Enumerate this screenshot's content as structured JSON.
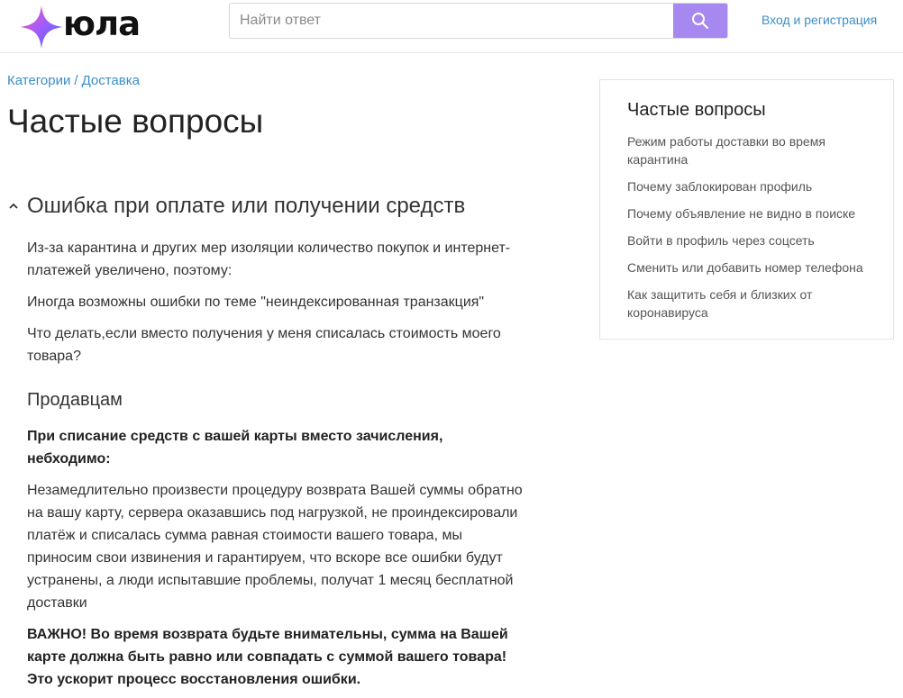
{
  "header": {
    "logo_text": "юла",
    "search_placeholder": "Найти ответ",
    "login_label": "Вход и регистрация"
  },
  "breadcrumb": {
    "items": [
      "Категории",
      "Доставка"
    ],
    "separator": "/"
  },
  "page_title": "Частые вопросы",
  "article": {
    "question": "Ошибка при оплате или получении средств",
    "paragraphs": [
      "Из-за карантина и других мер изоляции количество покупок и интернет-платежей увеличено, поэтому:",
      "Иногда возможны ошибки по теме \"неиндексированная транзакция\"",
      "Что делать,если вместо получения у меня списалась стоимость моего товара?"
    ],
    "subheading": "Продавцам",
    "bold_instruction": "При списание средств с вашей карты вместо зачисления, небходимо:",
    "body": "Незамедлительно произвести процедуру возврата Вашей суммы обратно на вашу карту, сервера оказавшись под нагрузкой, не проиндексировали платёж и списалась сумма равная стоимости вашего товара, мы приносим свои извинения и гарантируем, что вскоре все ошибки будут устранены, а люди испытавшие проблемы, получат 1 месяц бесплатной доставки",
    "warning": "ВАЖНО! Во время возврата будьте внимательны, сумма на Вашей карте должна быть равно или совпадать с суммой вашего товара! Это ускорит процесс восстановления ошибки."
  },
  "sidebar": {
    "title": "Частые вопросы",
    "links": [
      "Режим работы доставки во время карантина",
      "Почему заблокирован профиль",
      "Почему объявление не видно в поиске",
      "Войти в профиль через соцсеть",
      "Сменить или добавить номер телефона",
      "Как защитить себя и близких от коронавируса"
    ]
  },
  "icons": {
    "logo": "star-sparkle-icon",
    "search": "search-icon",
    "question_toggle": "chevron-up-icon"
  },
  "colors": {
    "accent": "#a788f0",
    "link": "#3a8fc7",
    "logo_gradient": [
      "#ff5c9e",
      "#a15bff",
      "#3f6fff"
    ]
  }
}
